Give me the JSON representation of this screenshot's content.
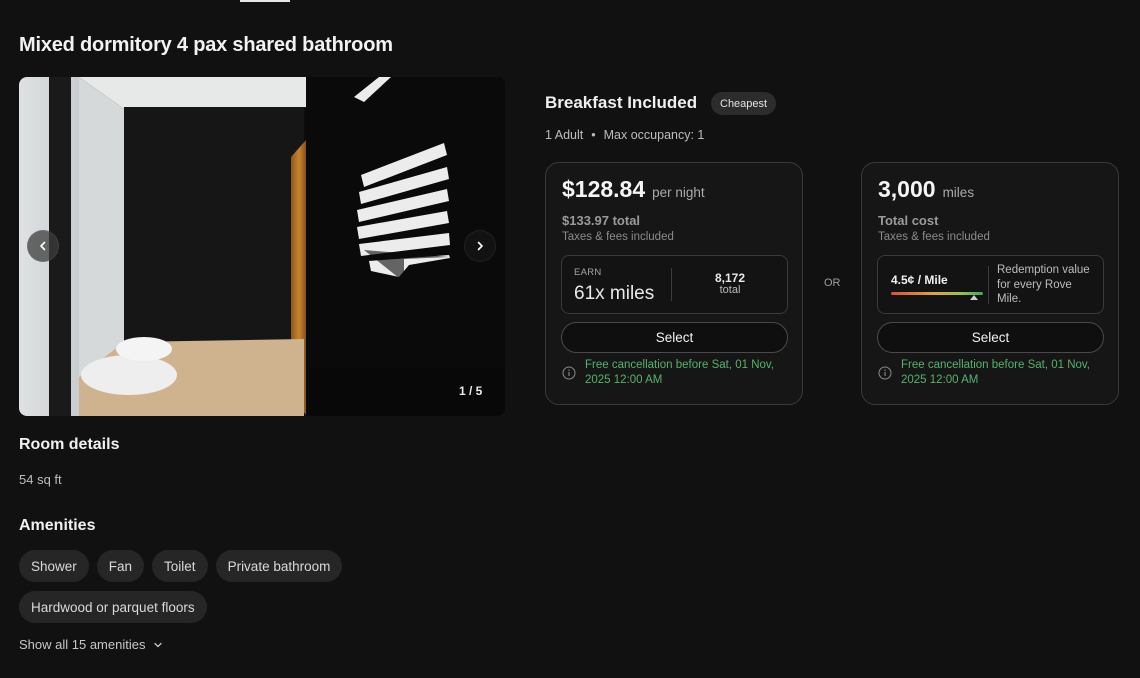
{
  "room": {
    "title": "Mixed dormitory 4 pax shared bathroom",
    "photo_counter": "1 / 5",
    "details_heading": "Room details",
    "size": "54 sq ft",
    "amenities_heading": "Amenities",
    "amenities": [
      "Shower",
      "Fan",
      "Toilet",
      "Private bathroom",
      "Hardwood or parquet floors"
    ],
    "show_all_label": "Show all 15 amenities"
  },
  "rate": {
    "title": "Breakfast Included",
    "badge": "Cheapest",
    "guests": "1 Adult",
    "separator": "•",
    "max_occupancy": "Max occupancy: 1",
    "or_label": "OR"
  },
  "cash_option": {
    "price": "$128.84",
    "price_unit": "per night",
    "total": "$133.97 total",
    "taxes_note": "Taxes & fees included",
    "earn_label": "EARN",
    "earn_value": "61x miles",
    "earn_total_number": "8,172",
    "earn_total_label": "total",
    "select_label": "Select",
    "cancellation": "Free cancellation before Sat, 01 Nov, 2025 12:00 AM"
  },
  "miles_option": {
    "price": "3,000",
    "price_unit": "miles",
    "total": "Total cost",
    "taxes_note": "Taxes & fees included",
    "rate_label": "4.5¢ / Mile",
    "rate_level": 0.9,
    "redemption_text": "Redemption value for every Rove Mile.",
    "select_label": "Select",
    "cancellation": "Free cancellation before Sat, 01 Nov, 2025 12:00 AM"
  },
  "colors": {
    "background": "#111111",
    "card_border": "#3a3a3a",
    "cancellation_green": "#55b36a",
    "chip_bg": "#262626"
  },
  "icons": {
    "prev": "chevron-left-icon",
    "next": "chevron-right-icon",
    "expand": "chevron-down-icon",
    "info": "info-icon"
  }
}
